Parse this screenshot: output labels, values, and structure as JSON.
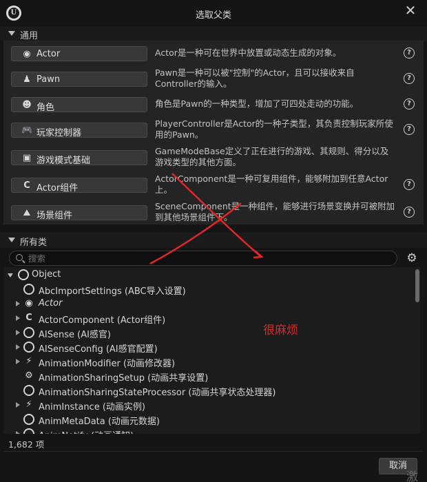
{
  "window": {
    "title": "选取父类",
    "close_glyph": "✕",
    "logo_letter": "U"
  },
  "common_section": {
    "header": "通用",
    "items": [
      {
        "label": "Actor",
        "icon": "actor-icon",
        "glyph": "◉",
        "desc": "Actor是一种可在世界中放置或动态生成的对象。"
      },
      {
        "label": "Pawn",
        "icon": "pawn-icon",
        "glyph": "♟",
        "desc": "Pawn是一种可以被\"控制\"的Actor，且可以接收来自Controller的输入。"
      },
      {
        "label": "角色",
        "icon": "character-icon",
        "glyph": "☻",
        "desc": "角色是Pawn的一种类型，增加了可四处走动的功能。"
      },
      {
        "label": "玩家控制器",
        "icon": "gamepad-icon",
        "glyph": "🎮",
        "desc": "PlayerController是Actor的一种子类型，其负责控制玩家所使用的Pawn。"
      },
      {
        "label": "游戏模式基础",
        "icon": "game-mode-icon",
        "glyph": "▣",
        "desc": "GameModeBase定义了正在进行的游戏、其规则、得分以及游戏类型的其他方面。"
      },
      {
        "label": "Actor组件",
        "icon": "actor-component-icon",
        "glyph": "C",
        "desc": "ActorComponent是一种可复用组件，能够附加到任意Actor上。"
      },
      {
        "label": "场景组件",
        "icon": "scene-component-icon",
        "glyph": "⛰",
        "desc": "SceneComponent是一种组件，能够进行场景变换并可被附加到其他场景组件下。"
      }
    ],
    "help_glyph": "?"
  },
  "all_classes_section": {
    "header": "所有类",
    "search_placeholder": "搜索",
    "settings_glyph": "⚙",
    "tree": [
      {
        "label": "Object",
        "icon": "object-icon",
        "glyph": "●",
        "expander": "open",
        "indent": 0,
        "italic": false
      },
      {
        "label": "AbcImportSettings (ABC导入设置)",
        "icon": "object-icon",
        "glyph": "●",
        "expander": "none",
        "indent": 1,
        "italic": false
      },
      {
        "label": "Actor",
        "icon": "actor-icon",
        "glyph": "◉",
        "expander": "closed",
        "indent": 1,
        "italic": true
      },
      {
        "label": "ActorComponent (Actor组件)",
        "icon": "actor-component-icon",
        "glyph": "C",
        "expander": "closed",
        "indent": 1,
        "italic": false
      },
      {
        "label": "AISense (AI感官)",
        "icon": "object-icon",
        "glyph": "●",
        "expander": "closed",
        "indent": 1,
        "italic": false
      },
      {
        "label": "AISenseConfig (AI感官配置)",
        "icon": "object-icon",
        "glyph": "●",
        "expander": "closed",
        "indent": 1,
        "italic": false
      },
      {
        "label": "AnimationModifier (动画修改器)",
        "icon": "animation-icon",
        "glyph": "⚡",
        "expander": "closed",
        "indent": 1,
        "italic": false
      },
      {
        "label": "AnimationSharingSetup (动画共享设置)",
        "icon": "animation-sharing-icon",
        "glyph": "⚙",
        "expander": "none",
        "indent": 1,
        "italic": false
      },
      {
        "label": "AnimationSharingStateProcessor (动画共享状态处理器)",
        "icon": "object-icon",
        "glyph": "●",
        "expander": "none",
        "indent": 1,
        "italic": false
      },
      {
        "label": "AnimInstance (动画实例)",
        "icon": "animation-icon",
        "glyph": "⚡",
        "expander": "closed",
        "indent": 1,
        "italic": false
      },
      {
        "label": "AnimMetaData (动画元数据)",
        "icon": "object-icon",
        "glyph": "●",
        "expander": "none",
        "indent": 1,
        "italic": false
      },
      {
        "label": "AnimNotify (动画通知)",
        "icon": "object-icon",
        "glyph": "●",
        "expander": "closed",
        "indent": 1,
        "italic": false
      }
    ]
  },
  "footer": {
    "count": "1,682 项",
    "cancel_label": "取消"
  },
  "annotation": {
    "text": "很麻烦",
    "color": "#e02828"
  },
  "watermark": "激活"
}
